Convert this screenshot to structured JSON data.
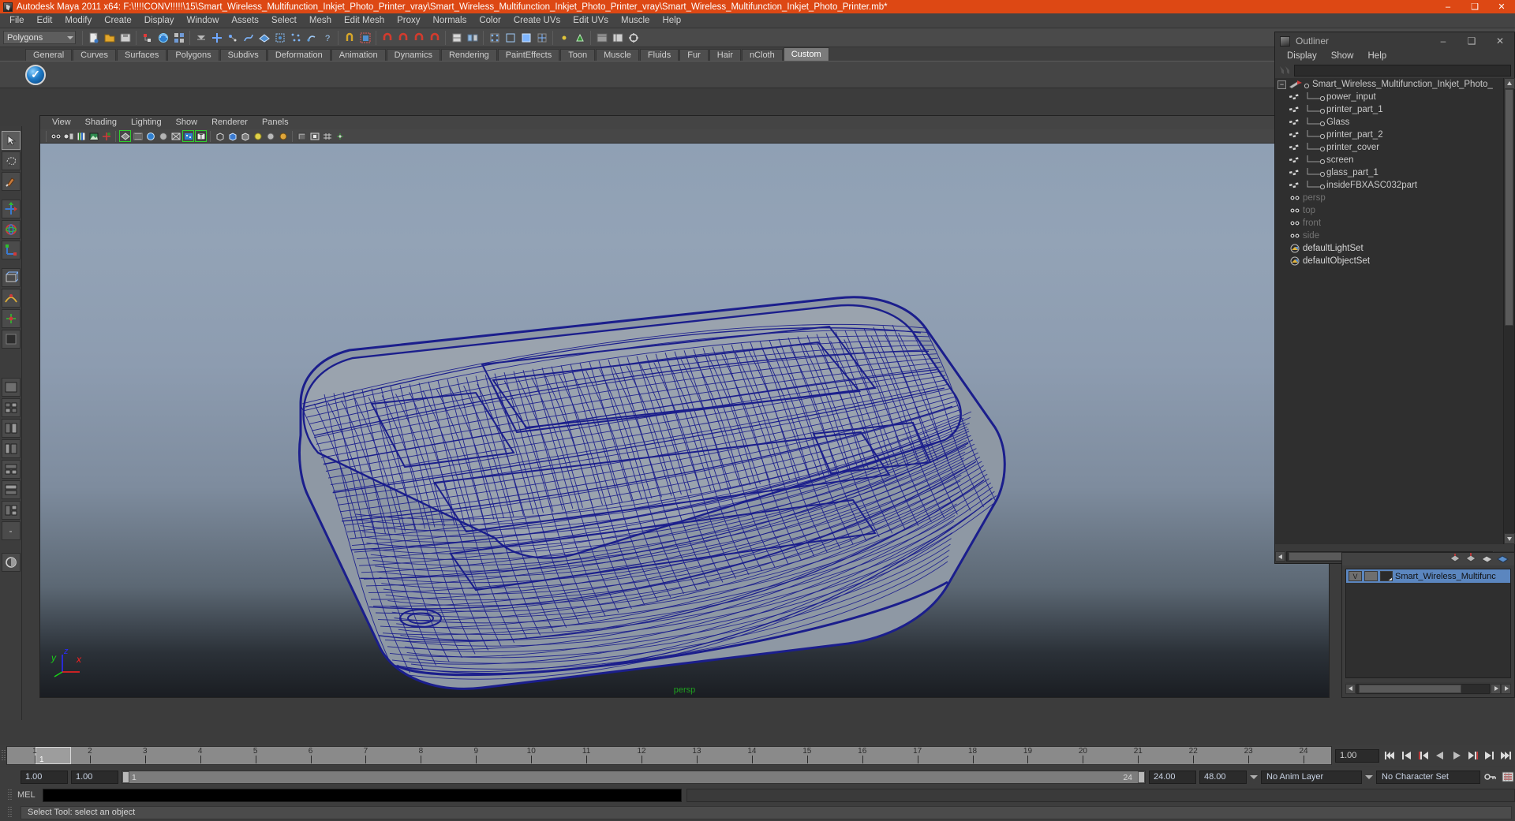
{
  "window": {
    "title": "Autodesk Maya 2011 x64: F:\\!!!!CONV!!!!!\\15\\Smart_Wireless_Multifunction_Inkjet_Photo_Printer_vray\\Smart_Wireless_Multifunction_Inkjet_Photo_Printer_vray\\Smart_Wireless_Multifunction_Inkjet_Photo_Printer.mb*",
    "icon": "maya-app-icon",
    "minimize": "–",
    "maximize": "❑",
    "close": "✕",
    "accent": "#dd4814"
  },
  "menubar": {
    "items": [
      "File",
      "Edit",
      "Modify",
      "Create",
      "Display",
      "Window",
      "Assets",
      "Select",
      "Mesh",
      "Edit Mesh",
      "Proxy",
      "Normals",
      "Color",
      "Create UVs",
      "Edit UVs",
      "Muscle",
      "Help"
    ]
  },
  "toolbar": {
    "mode_selector": {
      "value": "Polygons"
    }
  },
  "shelf": {
    "tabs": [
      "General",
      "Curves",
      "Surfaces",
      "Polygons",
      "Subdivs",
      "Deformation",
      "Animation",
      "Dynamics",
      "Rendering",
      "PaintEffects",
      "Toon",
      "Muscle",
      "Fluids",
      "Fur",
      "Hair",
      "nCloth",
      "Custom"
    ],
    "active_tab": "Custom",
    "item_icon": "vray-checkmark-icon"
  },
  "viewport": {
    "menus": [
      "View",
      "Shading",
      "Lighting",
      "Show",
      "Renderer",
      "Panels"
    ],
    "camera_label": "persp",
    "axis": {
      "x": "x",
      "y": "y",
      "z": "z",
      "x_color": "#ff2020",
      "y_color": "#18d018",
      "z_color": "#2a2aff"
    },
    "wireframe_color": "#1b1e8c",
    "background_top": "#8fa0b4",
    "background_bottom": "#1a1d22"
  },
  "outliner": {
    "title": "Outliner",
    "window_buttons": {
      "minimize": "–",
      "maximize": "❑",
      "close": "✕"
    },
    "menus": [
      "Display",
      "Show",
      "Help"
    ],
    "search_value": "",
    "rows": [
      {
        "label": "Smart_Wireless_Multifunction_Inkjet_Photo_",
        "depth": 0,
        "icon": "transform-icon",
        "style": "root",
        "expander": "−"
      },
      {
        "label": "power_input",
        "depth": 1,
        "icon": "mesh-icon",
        "style": "normal"
      },
      {
        "label": "printer_part_1",
        "depth": 1,
        "icon": "mesh-icon",
        "style": "normal"
      },
      {
        "label": "Glass",
        "depth": 1,
        "icon": "mesh-icon",
        "style": "normal"
      },
      {
        "label": "printer_part_2",
        "depth": 1,
        "icon": "mesh-icon",
        "style": "normal"
      },
      {
        "label": "printer_cover",
        "depth": 1,
        "icon": "mesh-icon",
        "style": "normal"
      },
      {
        "label": "screen",
        "depth": 1,
        "icon": "mesh-icon",
        "style": "normal"
      },
      {
        "label": "glass_part_1",
        "depth": 1,
        "icon": "mesh-icon",
        "style": "normal"
      },
      {
        "label": "insideFBXASC032part",
        "depth": 1,
        "icon": "mesh-icon",
        "style": "normal"
      },
      {
        "label": "persp",
        "depth": 0,
        "icon": "camera-icon",
        "style": "dim"
      },
      {
        "label": "top",
        "depth": 0,
        "icon": "camera-icon",
        "style": "dim"
      },
      {
        "label": "front",
        "depth": 0,
        "icon": "camera-icon",
        "style": "dim"
      },
      {
        "label": "side",
        "depth": 0,
        "icon": "camera-icon",
        "style": "dim"
      },
      {
        "label": "defaultLightSet",
        "depth": 0,
        "icon": "set-icon",
        "style": "bold"
      },
      {
        "label": "defaultObjectSet",
        "depth": 0,
        "icon": "set-icon",
        "style": "bold"
      }
    ]
  },
  "layer_editor": {
    "layers": [
      {
        "visibility": "V",
        "playback": "",
        "name": "Smart_Wireless_Multifunc",
        "color": "#5b86bf"
      }
    ]
  },
  "time_slider": {
    "ticks": [
      1,
      2,
      3,
      4,
      5,
      6,
      7,
      8,
      9,
      10,
      11,
      12,
      13,
      14,
      15,
      16,
      17,
      18,
      19,
      20,
      21,
      22,
      23,
      24
    ],
    "current_frame": "1",
    "frame_field": "1.00",
    "playback_buttons": [
      "go-to-start",
      "step-back-key",
      "step-back-frame",
      "play-backwards",
      "play-forwards",
      "step-forward-frame",
      "step-forward-key",
      "go-to-end"
    ]
  },
  "range_slider": {
    "start_field": "1.00",
    "range_start_field": "1.00",
    "bar_start_label": "1",
    "bar_end_label": "24",
    "range_end_field": "24.00",
    "end_field": "48.00",
    "anim_layer": "No Anim Layer",
    "character_set": "No Character Set",
    "key_icon": "key-icon",
    "auto_key_icon": "auto-keyframe-icon",
    "prefs_icon": "animation-preferences-icon"
  },
  "command_line": {
    "label": "MEL",
    "value": "",
    "output": ""
  },
  "status_bar": {
    "message": "Select Tool: select an object"
  },
  "toolbox": {
    "tools": [
      "select-tool",
      "lasso-select-tool",
      "paint-select-tool",
      "move-tool",
      "rotate-tool",
      "scale-tool",
      "universal-manipulator-tool",
      "soft-modification-tool",
      "show-manipulator-tool",
      "last-tool-used",
      "single-pane-layout",
      "two-pane-side-layout",
      "two-pane-stacked-layout",
      "three-pane-layout",
      "four-pane-layout",
      "persp-outliner-layout",
      "hypergraph-layout",
      "multi-layout",
      "expand-layouts",
      "paint-effects-globals"
    ]
  }
}
